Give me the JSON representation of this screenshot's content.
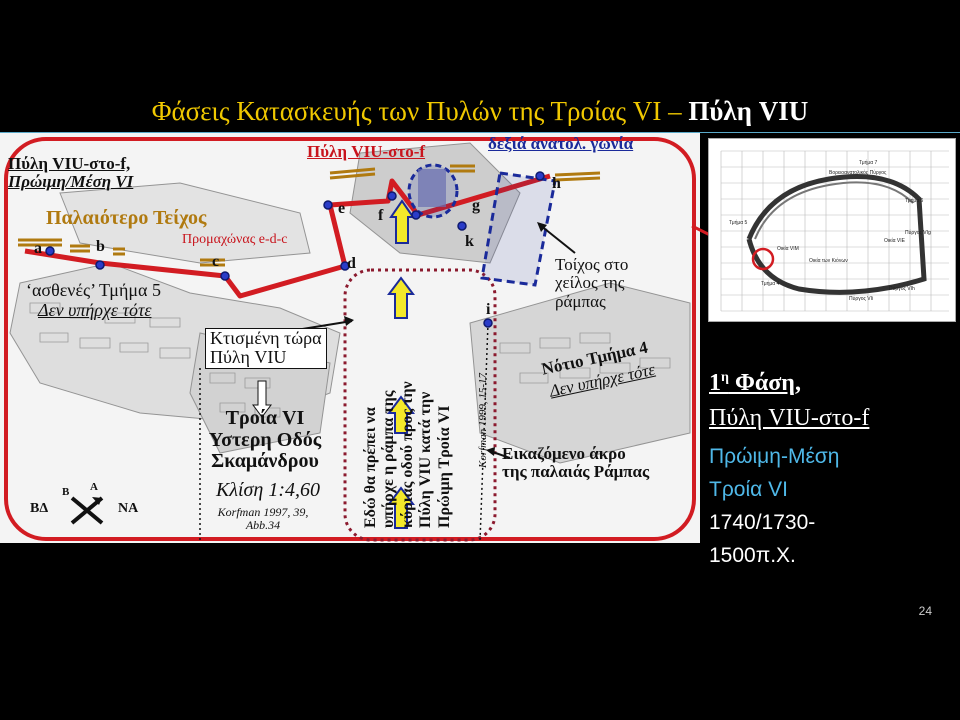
{
  "slide": {
    "title_main": "Φάσεις Κατασκευής των Πυλών της Τροίας VI – ",
    "title_bold": "Πύλη VIU",
    "page_number": "24"
  },
  "plan_labels": {
    "gate_f_title_1": "Πύλη VIU-στο-f,",
    "gate_f_title_2": "Πρώιμη/Μέση VI",
    "old_wall": "Παλαιότερο Τείχος",
    "bastion": "Προμαχώνας e-d-c",
    "gate_f_top": "Πύλη VIU-στο-f",
    "se_corner": "δεξιά ανατολ. γωνία",
    "weak_section": "‘ασθενές’ Τμήμα 5",
    "not_exist_1": "Δεν υπήρχε τότε",
    "built_now_1": "Κτισμένη τώρα",
    "built_now_2": "Πύλη VIU",
    "troy_road_1": "Τροία VI",
    "troy_road_2": "Υστερη Οδός",
    "troy_road_3": "Σκαμάνδρου",
    "slope": "Κλίση 1:4,60",
    "ref_1": "Korfman 1997, 39,",
    "ref_2": "Abb.34",
    "ramp_wall_1": "Τοίχος στο",
    "ramp_wall_2": "χείλος της",
    "ramp_wall_3": "ράμπας",
    "south_section": "Νότιο Τμήμα 4",
    "not_exist_2": "Δεν υπήρχε τότε",
    "ramp_edge_1": "Εικαζόμενο άκρο",
    "ramp_edge_2": "της παλαιάς Ράμπας",
    "ref_korfman_1999": "Korfman 1999, 15-17",
    "vertical_1": "Εδώ θα πρέπει να",
    "vertical_2": "υπήρχε η ράμπα της",
    "vertical_3": "κύριας οδού προς την",
    "vertical_4": "Πύλη VIU κατά την",
    "vertical_5": "Πρώιμη Τροία VI",
    "compass_nw": "ΒΔ",
    "compass_ne": "ΝΑ",
    "compass_b": "Β",
    "compass_a": "Α",
    "points": [
      "a",
      "b",
      "c",
      "d",
      "e",
      "f",
      "g",
      "h",
      "i",
      "k"
    ]
  },
  "side_panel": {
    "phase_num": "1",
    "phase_sup": "η",
    "phase_word": " Φάση",
    "phase_comma": ",",
    "gate": "Πύλη VIU-στο-f",
    "period_1": "Πρώιμη-Μέση",
    "period_2": "Τροία VI",
    "date_1": "1740/1730-",
    "date_2": "1500π.Χ."
  },
  "inset_map": {
    "labels": [
      "Τμήμα 7",
      "Βορειοανατολικός Πύργος",
      "Τμήμα 6",
      "Πύργος VIg",
      "Οικία VIE",
      "Τμήμα 5",
      "Οικία VIM",
      "Οικία των Κιόνων",
      "Τμήμα 4",
      "Πύργος VIh",
      "Πύργος VIi"
    ],
    "cols": [
      "Z",
      "A",
      "B",
      "C",
      "D",
      "E",
      "F",
      "G",
      "H",
      "I",
      "K"
    ],
    "rows": [
      "1",
      "2",
      "3",
      "4",
      "5",
      "6",
      "7",
      "8",
      "9",
      "10"
    ]
  },
  "colors": {
    "title": "#f0c800",
    "wall_line": "#d21c22",
    "navy": "#1a2a9a",
    "side_cyan": "#4fb8e8"
  }
}
